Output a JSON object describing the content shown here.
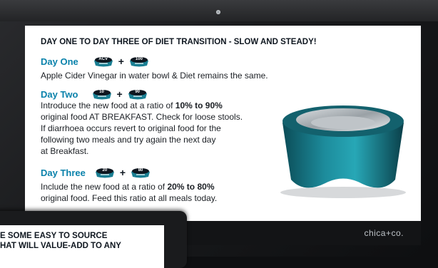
{
  "title": "DAY ONE TO DAY THREE OF DIET TRANSITION - SLOW AND STEADY!",
  "day_one": {
    "label": "Day One",
    "bowls": [
      "ACV",
      "100"
    ],
    "line": "Apple Cider Vinegar in water bowl & Diet remains the same."
  },
  "day_two": {
    "label": "Day Two",
    "bowls": [
      "10",
      "90"
    ],
    "line1_pre": "Introduce the new food at a ratio of ",
    "line1_bold": "10% to 90%",
    "line2": "original food AT BREAKFAST. Check for loose stools.",
    "line3": "If diarrhoea occurs revert to original food for the",
    "line4": "following two meals and try again the next day",
    "line5": "at Breakfast."
  },
  "day_three": {
    "label": "Day Three",
    "bowls": [
      "20",
      "80"
    ],
    "line1_pre": "Include the new food at a ratio of ",
    "line1_bold": "20% to 80%",
    "line2": "original food. Feed this ratio at all meals today."
  },
  "brand": "chica+co.",
  "bottom_screen": {
    "line1": "E SOME EASY TO SOURCE",
    "line2": "HAT WILL VALUE-ADD TO ANY"
  },
  "colors": {
    "accent": "#0a82ab",
    "teal": "#117f90"
  }
}
